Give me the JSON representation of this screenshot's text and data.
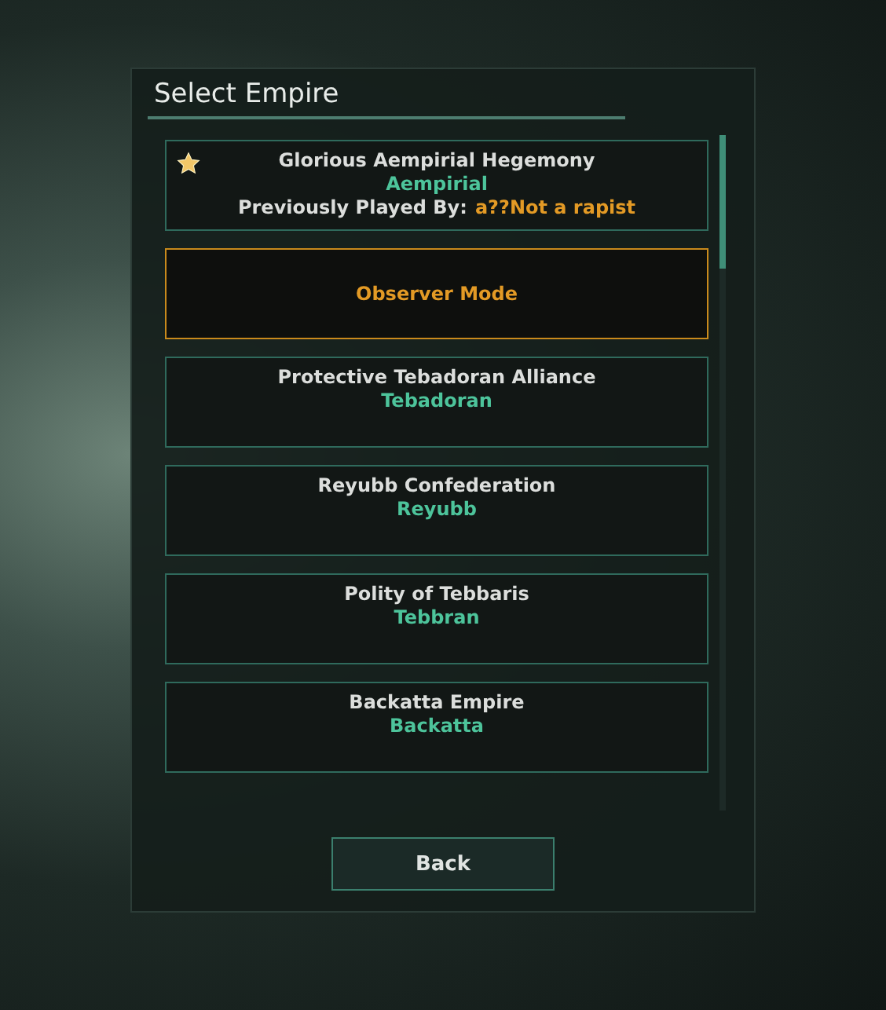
{
  "dialog": {
    "title": "Select Empire"
  },
  "empires": [
    {
      "kind": "empire",
      "name": "Glorious Aempirial Hegemony",
      "species": "Aempirial",
      "played_by_label": "Previously Played By:",
      "played_by": "a??Not a rapist",
      "favorite": true,
      "selected": false
    },
    {
      "kind": "observer",
      "name": "Observer Mode",
      "favorite": false,
      "selected": true
    },
    {
      "kind": "empire",
      "name": "Protective Tebadoran Alliance",
      "species": "Tebadoran",
      "favorite": false,
      "selected": false
    },
    {
      "kind": "empire",
      "name": "Reyubb Confederation",
      "species": "Reyubb",
      "favorite": false,
      "selected": false
    },
    {
      "kind": "empire",
      "name": "Polity of Tebbaris",
      "species": "Tebbran",
      "favorite": false,
      "selected": false
    },
    {
      "kind": "empire",
      "name": "Backatta Empire",
      "species": "Backatta",
      "favorite": false,
      "selected": false
    }
  ],
  "buttons": [
    {
      "label": "Back"
    }
  ]
}
